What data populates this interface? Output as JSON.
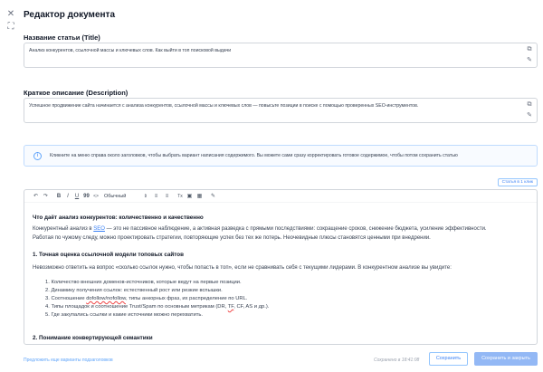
{
  "header": {
    "title": "Редактор документа"
  },
  "side_tools": {
    "close_icon": "close-icon",
    "expand_icon": "expand-icon"
  },
  "title_field": {
    "label": "Название статьи (Title)",
    "value": "Анализ конкурентов, ссылочной массы и ключевых слов. Как выйти в топ поисковой выдачи"
  },
  "description_field": {
    "label": "Краткое описание (Description)",
    "value": "Успешное продвижение сайта начинается с анализа конкурентов, ссылочной массы и ключевых слов — повысьте позиции в поиске с помощью проверенных SEO-инструментов."
  },
  "info": {
    "text": "Кликните на меню справа около заголовков, чтобы выбрать вариант написания содержимого. Вы можете сами сразу корректировать готовое содержимое, чтобы потом сохранить статью"
  },
  "count_button": "Статья в 1 клик",
  "toolbar": {
    "undo": "↶",
    "redo": "↷",
    "bold": "B",
    "italic": "I",
    "underline": "U",
    "quote": "99",
    "code": "<>",
    "style_select": "Обычный",
    "ordered_list": "≡",
    "bullet_list": "≡",
    "clear_format": "Tx",
    "image": "▣",
    "table": "▦",
    "magic": "✎"
  },
  "content": {
    "h1": "Что даёт анализ конкурентов: количественно и качественно",
    "p1_a": "Конкурентный анализ в ",
    "p1_link": "SEO",
    "p1_b": " — это не пассивное наблюдение, а активная разведка с прямыми последствиями: сокращение сроков, снижение бюджета, усиление эффективности.",
    "p1_line2": "Работая по чужому следу, можно проектировать стратегии, повторяющие успех без тех же потерь. Неочевидные плюсы становятся ценными при внедрении.",
    "h2": "1. Точная оценка ссылочной модели топовых сайтов",
    "p2": "Невозможно ответить на вопрос «сколько ссылок нужно, чтобы попасть в топ», если не сравнивать себя с текущими лидерами. В конкурентном анализе вы увидите:",
    "list": [
      "1. Количество внешних доменов-источников, которые ведут на первые позиции.",
      "2. Динамику получения ссылок: естественный рост или резкие вспышки."
    ],
    "li3_a": "3. Соотношение ",
    "li3_squig": "dofollow/nofollow",
    "li3_b": ", типы анкорных фраз, их распределение по URL.",
    "li4_a": "4. Типы площадок и соотношение Trust/Spam по основным метрикам (DR, ",
    "li4_squig": "TF",
    "li4_b": ", CF, AS и др.).",
    "li5": "5. Где закупались ссылки и какие источники можно перехватить.",
    "h3": "2. Понимание конвертирующей семантики"
  },
  "footer": {
    "suggest_link": "Предложить еще варианты подзаголовков",
    "saved_text": "Сохранено в 18:41:08",
    "save_button": "Сохранить",
    "save_close_button": "Сохранить и закрыть"
  }
}
